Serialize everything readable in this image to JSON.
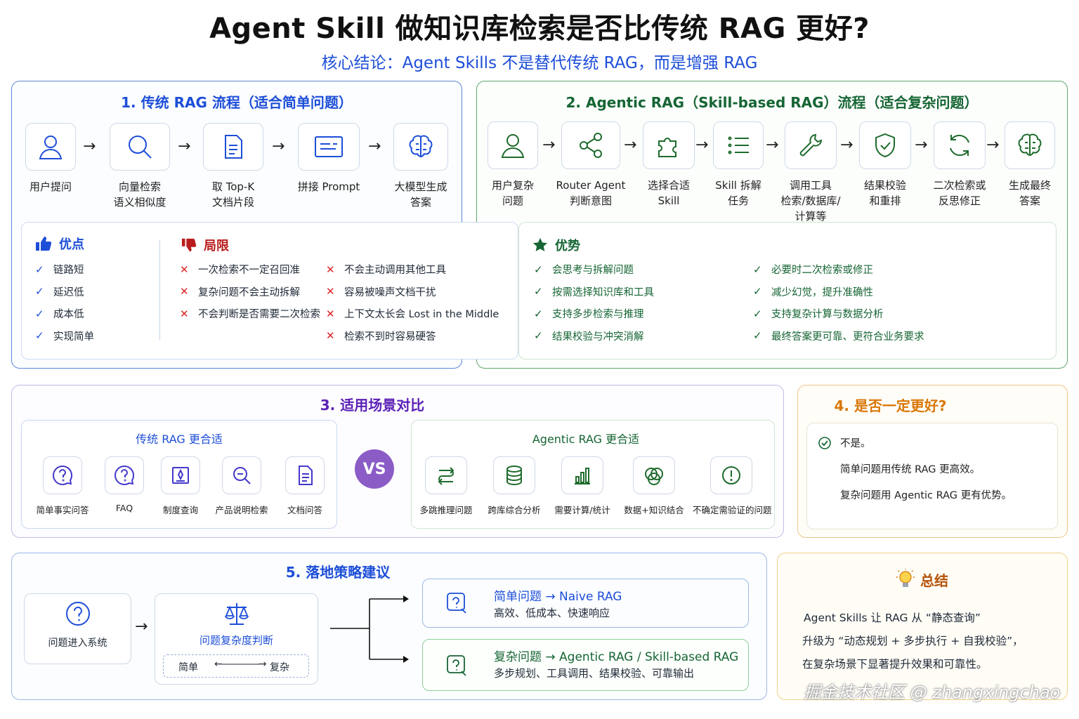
{
  "title": "Agent Skill 做知识库检索是否比传统 RAG 更好?",
  "subtitle": "核心结论：Agent Skills 不是替代传统 RAG，而是增强 RAG",
  "section1": {
    "title": "1. 传统 RAG 流程（适合简单问题）",
    "steps": [
      "用户提问",
      "向量检索\n语义相似度",
      "取 Top-K\n文档片段",
      "拼接 Prompt",
      "大模型生成\n答案"
    ],
    "pros_title": "优点",
    "pros": [
      "链路短",
      "延迟低",
      "成本低",
      "实现简单"
    ],
    "cons_title": "局限",
    "cons_left": [
      "一次检索不一定召回准",
      "复杂问题不会主动拆解",
      "不会判断是否需要二次检索"
    ],
    "cons_right": [
      "不会主动调用其他工具",
      "容易被噪声文档干扰",
      "上下文太长会 Lost in the Middle",
      "检索不到时容易硬答"
    ]
  },
  "section2": {
    "title": "2. Agentic RAG（Skill-based RAG）流程（适合复杂问题）",
    "steps": [
      "用户复杂\n问题",
      "Router Agent\n判断意图",
      "选择合适\nSkill",
      "Skill 拆解\n任务",
      "调用工具\n检索/数据库/\n计算等",
      "结果校验\n和重排",
      "二次检索或\n反思修正",
      "生成最终\n答案"
    ],
    "adv_title": "优势",
    "adv_left": [
      "会思考与拆解问题",
      "按需选择知识库和工具",
      "支持多步检索与推理",
      "结果校验与冲突消解"
    ],
    "adv_right": [
      "必要时二次检索或修正",
      "减少幻觉，提升准确性",
      "支持复杂计算与数据分析",
      "最终答案更可靠、更符合业务要求"
    ]
  },
  "section3": {
    "title": "3. 适用场景对比",
    "left_title": "传统 RAG 更合适",
    "left_items": [
      "简单事实问答",
      "FAQ",
      "制度查询",
      "产品说明检索",
      "文档问答"
    ],
    "vs": "VS",
    "right_title": "Agentic RAG 更合适",
    "right_items": [
      "多跳推理问题",
      "跨库综合分析",
      "需要计算/统计",
      "数据+知识结合",
      "不确定需验证的问题"
    ]
  },
  "section4": {
    "title": "4. 是否一定更好?",
    "answer": "不是。",
    "line1": "简单问题用传统 RAG 更高效。",
    "line2": "复杂问题用 Agentic RAG 更有优势。"
  },
  "section5": {
    "title": "5. 落地策略建议",
    "entry": "问题进入系统",
    "judge": "问题复杂度判断",
    "simple": "简单",
    "complex": "复杂",
    "route1_title": "简单问题 → Naive RAG",
    "route1_desc": "高效、低成本、快速响应",
    "route2_title": "复杂问题 → Agentic RAG / Skill-based RAG",
    "route2_desc": "多步规划、工具调用、结果校验、可靠输出"
  },
  "summary": {
    "title": "总结",
    "line1": "Agent Skills 让 RAG 从 “静态查询”",
    "line2": "升级为 “动态规划 + 多步执行 + 自我校验”，",
    "line3": "在复杂场景下显著提升效果和可靠性。"
  },
  "watermark": "掘金技术社区 @ zhangxingchao",
  "colors": {
    "blue": "#1d4ed8",
    "green": "#166534",
    "purple": "#5b21b6",
    "orange": "#d97706",
    "red": "#dc2626"
  }
}
